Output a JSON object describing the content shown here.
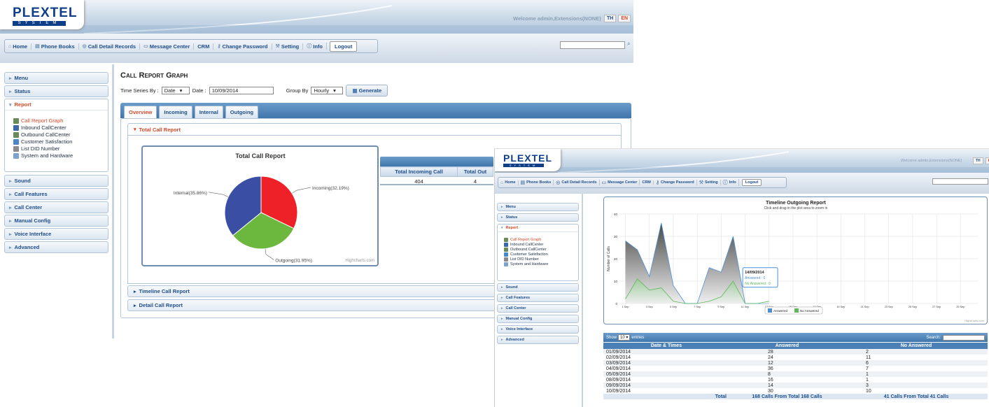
{
  "brand": {
    "name": "PLEXTEL",
    "tagline": "SYSTEM"
  },
  "header": {
    "welcome": "Welcome admin,Extensions(NONE)",
    "lang_th": "TH",
    "lang_en": "EN"
  },
  "nav": {
    "home": "Home",
    "phone_books": "Phone Books",
    "cdr": "Call Detail Records",
    "message_center": "Message Center",
    "crm": "CRM",
    "change_password": "Change Password",
    "setting": "Setting",
    "info": "Info",
    "logout": "Logout"
  },
  "sidebar": {
    "menu": "Menu",
    "status": "Status",
    "report": "Report",
    "report_items": [
      "Call Report Graph",
      "Inbound CallCenter",
      "Outbound CallCenter",
      "Customer Satisfaction",
      "List DID Number",
      "System and Hardware"
    ],
    "sound": "Sound",
    "call_features": "Call Features",
    "call_center": "Call Center",
    "manual_config": "Manual Config",
    "voice_interface": "Voice Interface",
    "advanced": "Advanced"
  },
  "main": {
    "title": "Call Report Graph",
    "time_series_label": "Time Series By :",
    "time_series_value": "Date",
    "date_label": "Date :",
    "date_value": "10/09/2014",
    "group_by_label": "Group By",
    "group_by_value": "Hourly",
    "generate": "Generate",
    "tabs": [
      "Overview",
      "Incoming",
      "Internal",
      "Outgoing"
    ],
    "total_section": "Total Call Report",
    "timeline_section": "Timeline Call Report",
    "detail_section": "Detail Call Report",
    "table_headers": [
      "Total Incoming Call",
      "Total Out"
    ],
    "table_values": [
      "404",
      "4"
    ],
    "credit": "Highcharts.com"
  },
  "chart_data": [
    {
      "type": "pie",
      "title": "Total Call Report",
      "categories": [
        "Incoming",
        "Outgoing",
        "Internal"
      ],
      "values": [
        32.19,
        31.95,
        35.86
      ],
      "labels": [
        "Incoming(32.19%)",
        "Outgoing(31.95%)",
        "Internal(35.86%)"
      ],
      "colors": [
        "#ee2028",
        "#6cb73e",
        "#3a4fa3"
      ]
    },
    {
      "type": "area",
      "title": "Timeline Outgoing Report",
      "subtitle": "Click and drag in the plot area to zoom in",
      "ylabel": "Number of Calls",
      "ylim": [
        0,
        40
      ],
      "y_ticks": [
        "0",
        "10",
        "20",
        "30",
        "40"
      ],
      "x_ticks": [
        "1 Sep",
        "3 Sep",
        "5 Sep",
        "7 Sep",
        "9 Sep",
        "11 Sep",
        "13 Sep",
        "15 Sep",
        "17 Sep",
        "19 Sep",
        "21 Sep",
        "23 Sep",
        "25 Sep",
        "27 Sep",
        "29 Sep"
      ],
      "series": [
        {
          "name": "Answered",
          "color": "#4a90d9",
          "x": [
            1,
            2,
            3,
            4,
            5,
            6,
            7,
            8,
            9,
            10,
            11,
            12,
            13
          ],
          "values": [
            28,
            24,
            12,
            36,
            8,
            0,
            0,
            16,
            14,
            30,
            0,
            0,
            0
          ]
        },
        {
          "name": "No Answered",
          "color": "#5cb85c",
          "x": [
            1,
            2,
            3,
            4,
            5,
            6,
            7,
            8,
            9,
            10,
            11,
            12,
            13
          ],
          "values": [
            2,
            11,
            6,
            7,
            1,
            0,
            0,
            1,
            3,
            10,
            0,
            0,
            1
          ]
        }
      ],
      "tooltip": {
        "date": "14/09/2014",
        "answered_label": "Answered",
        "answered": "0",
        "no_answered_label": "No Answered",
        "no_answered": "0"
      }
    }
  ],
  "table2": {
    "show": "Show",
    "entries_value": "10",
    "entries": "entries",
    "search": "Search:",
    "headers": [
      "Date & Times",
      "Answered",
      "No Answered"
    ],
    "rows": [
      [
        "01/09/2014",
        "28",
        "2"
      ],
      [
        "02/09/2014",
        "24",
        "11"
      ],
      [
        "03/09/2014",
        "12",
        "6"
      ],
      [
        "04/09/2014",
        "36",
        "7"
      ],
      [
        "05/09/2014",
        "8",
        "1"
      ],
      [
        "08/09/2014",
        "16",
        "1"
      ],
      [
        "09/09/2014",
        "14",
        "3"
      ],
      [
        "10/09/2014",
        "30",
        "10"
      ]
    ],
    "total_label": "Total",
    "total_answered": "168 Calls From Total 168 Calls",
    "total_no_answered": "41 Calls From Total 41 Calls"
  }
}
